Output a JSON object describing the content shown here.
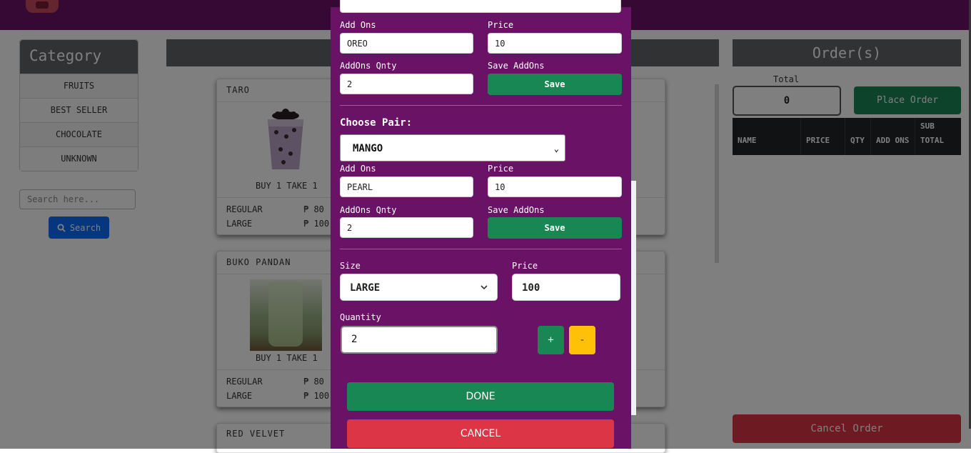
{
  "category": {
    "title": "Category",
    "items": [
      "FRUITS",
      "BEST SELLER",
      "CHOCOLATE",
      "UNKNOWN"
    ]
  },
  "search": {
    "placeholder": "Search here...",
    "button_label": "Search"
  },
  "products": [
    {
      "name": "TARO",
      "promo": "BUY 1 TAKE 1",
      "sizes": [
        {
          "size": "REGULAR",
          "price": "₱ 80"
        },
        {
          "size": "LARGE",
          "price": "₱ 100"
        }
      ]
    },
    {
      "name": "BUKO PANDAN",
      "promo": "BUY 1 TAKE 1",
      "sizes": [
        {
          "size": "REGULAR",
          "price": "₱ 80"
        },
        {
          "size": "LARGE",
          "price": "₱ 100"
        }
      ]
    },
    {
      "name": "RED VELVET"
    }
  ],
  "orders": {
    "title": "Order(s)",
    "total_label": "Total",
    "total_value": "0",
    "place_order": "Place Order",
    "columns": [
      "NAME",
      "PRICE",
      "QTY",
      "ADD ONS",
      "SUB TOTAL"
    ],
    "cancel_order": "Cancel Order"
  },
  "modal": {
    "addon_block_1": {
      "addons_label": "Add Ons",
      "addons_value": "OREO",
      "price_label": "Price",
      "price_value": "10",
      "qty_label": "AddOns Qnty",
      "qty_value": "2",
      "save_label": "Save AddOns",
      "save_button": "Save"
    },
    "choose_pair_label": "Choose Pair:",
    "pair_selected": "MANGO",
    "addon_block_2": {
      "addons_label": "Add Ons",
      "addons_value": "PEARL",
      "price_label": "Price",
      "price_value": "10",
      "qty_label": "AddOns Qnty",
      "qty_value": "2",
      "save_label": "Save AddOns",
      "save_button": "Save"
    },
    "size_label": "Size",
    "size_value": "LARGE",
    "price_label": "Price",
    "price_value": "100",
    "quantity_label": "Quantity",
    "quantity_value": "2",
    "plus": "+",
    "minus": "-",
    "done": "DONE",
    "cancel": "CANCEL"
  },
  "colors": {
    "brand_purple": "#6a1266",
    "success": "#198754",
    "danger": "#dc3545",
    "warning": "#ffc107",
    "primary": "#0d6efd"
  },
  "icons": [
    "search-icon",
    "chevron-down-icon"
  ]
}
